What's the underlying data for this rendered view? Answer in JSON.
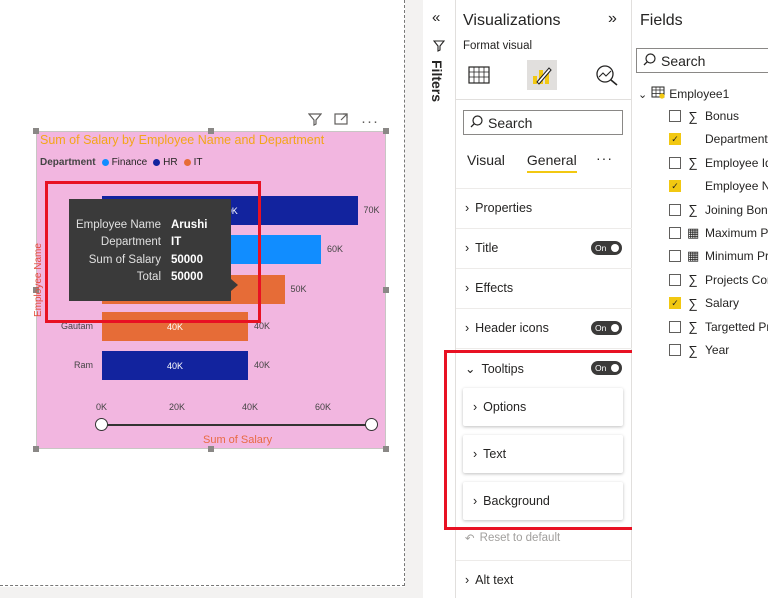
{
  "visual": {
    "title": "Sum of Salary by Employee Name and Department",
    "legend_title": "Department",
    "yaxis_title": "Employee Name",
    "xaxis_title": "Sum of Salary",
    "toolbar": {
      "filter_icon": "funnel-icon",
      "focus_icon": "focus-mode-icon",
      "more_icon": "more-options-icon"
    }
  },
  "chart_data": {
    "type": "bar",
    "orientation": "horizontal",
    "title": "Sum of Salary by Employee Name and Department",
    "xlabel": "Sum of Salary",
    "ylabel": "Employee Name",
    "legend": {
      "title": "Department",
      "position": "top-left",
      "entries": [
        {
          "name": "Finance",
          "color": "#118dff"
        },
        {
          "name": "HR",
          "color": "#12239e"
        },
        {
          "name": "IT",
          "color": "#e66c37"
        }
      ]
    },
    "xlim": [
      0,
      70000
    ],
    "xticks": [
      "0K",
      "20K",
      "40K",
      "60K"
    ],
    "bars": [
      {
        "category": "",
        "department": "HR",
        "value": 70000,
        "label": "70K",
        "end_label": "70K",
        "color": "#12239e"
      },
      {
        "category": "",
        "department": "Finance",
        "value": 60000,
        "label": "",
        "end_label": "60K",
        "color": "#118dff"
      },
      {
        "category": "",
        "department": "IT",
        "value": 50000,
        "label": "",
        "end_label": "50K",
        "color": "#e66c37"
      },
      {
        "category": "Gautam",
        "department": "IT",
        "value": 40000,
        "label": "40K",
        "end_label": "40K",
        "color": "#e66c37"
      },
      {
        "category": "Ram",
        "department": "HR",
        "value": 40000,
        "label": "40K",
        "end_label": "40K",
        "color": "#12239e"
      }
    ],
    "grid": false
  },
  "tooltip": {
    "rows": [
      {
        "key": "Employee Name",
        "value": "Arushi"
      },
      {
        "key": "Department",
        "value": "IT"
      },
      {
        "key": "Sum of Salary",
        "value": "50000"
      },
      {
        "key": "Total",
        "value": "50000"
      }
    ]
  },
  "filters": {
    "label": "Filters",
    "collapse_icon": "double-chevron-left-icon"
  },
  "visualizations": {
    "title": "Visualizations",
    "subtitle": "Format visual",
    "search_placeholder": "Search",
    "tabs": [
      {
        "label": "Visual"
      },
      {
        "label": "General",
        "active": true
      }
    ],
    "more": "···",
    "sections": [
      {
        "label": "Properties",
        "toggle": null
      },
      {
        "label": "Title",
        "toggle": "On"
      },
      {
        "label": "Effects",
        "toggle": null
      },
      {
        "label": "Header icons",
        "toggle": "On"
      },
      {
        "label": "Tooltips",
        "toggle": "On",
        "expanded": true
      }
    ],
    "tooltip_cards": [
      {
        "label": "Options"
      },
      {
        "label": "Text"
      },
      {
        "label": "Background"
      }
    ],
    "reset_label": "Reset to default",
    "alt_text": "Alt text"
  },
  "fields": {
    "title": "Fields",
    "search_placeholder": "Search",
    "table": "Employee1",
    "items": [
      {
        "label": "Bonus",
        "type": "sigma",
        "checked": false
      },
      {
        "label": "Department",
        "type": "none",
        "checked": true
      },
      {
        "label": "Employee Id",
        "type": "sigma",
        "checked": false
      },
      {
        "label": "Employee N",
        "type": "none",
        "checked": true
      },
      {
        "label": "Joining Bonu",
        "type": "sigma",
        "checked": false
      },
      {
        "label": "Maximum Pr",
        "type": "calc",
        "checked": false
      },
      {
        "label": "Minimum Pr",
        "type": "calc",
        "checked": false
      },
      {
        "label": "Projects Con",
        "type": "sigma",
        "checked": false
      },
      {
        "label": "Salary",
        "type": "sigma",
        "checked": true
      },
      {
        "label": "Targetted Pr",
        "type": "sigma",
        "checked": false
      },
      {
        "label": "Year",
        "type": "sigma",
        "checked": false
      }
    ]
  }
}
